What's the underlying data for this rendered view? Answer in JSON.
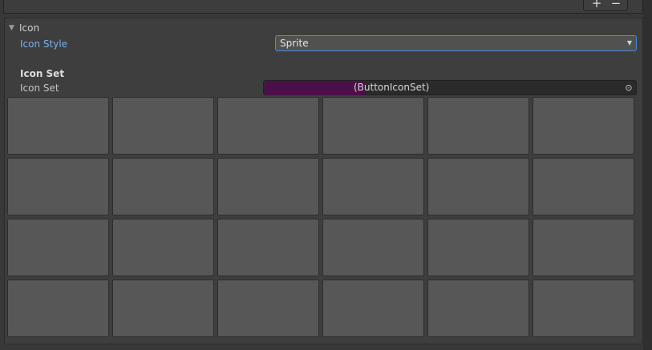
{
  "toolbar": {
    "add_label": "+",
    "remove_label": "−"
  },
  "icon_foldout": {
    "label": "Icon",
    "expanded": true
  },
  "icon_style": {
    "label": "Icon Style",
    "value": "Sprite"
  },
  "icon_set_section": {
    "header": "Icon Set"
  },
  "icon_set_field": {
    "label": "Icon Set",
    "value_suffix": "(ButtonIconSet)",
    "picker_icon": "object-picker-icon"
  },
  "icon_grid": {
    "rows": 4,
    "columns": 6,
    "cell_count": 24
  },
  "colors": {
    "background": "#383838",
    "panel": "#3e3e3e",
    "cell": "#575757",
    "accent_blue": "#4a8ad8",
    "label_blue": "#7bb0ee",
    "redaction": "#4b0f4a"
  }
}
